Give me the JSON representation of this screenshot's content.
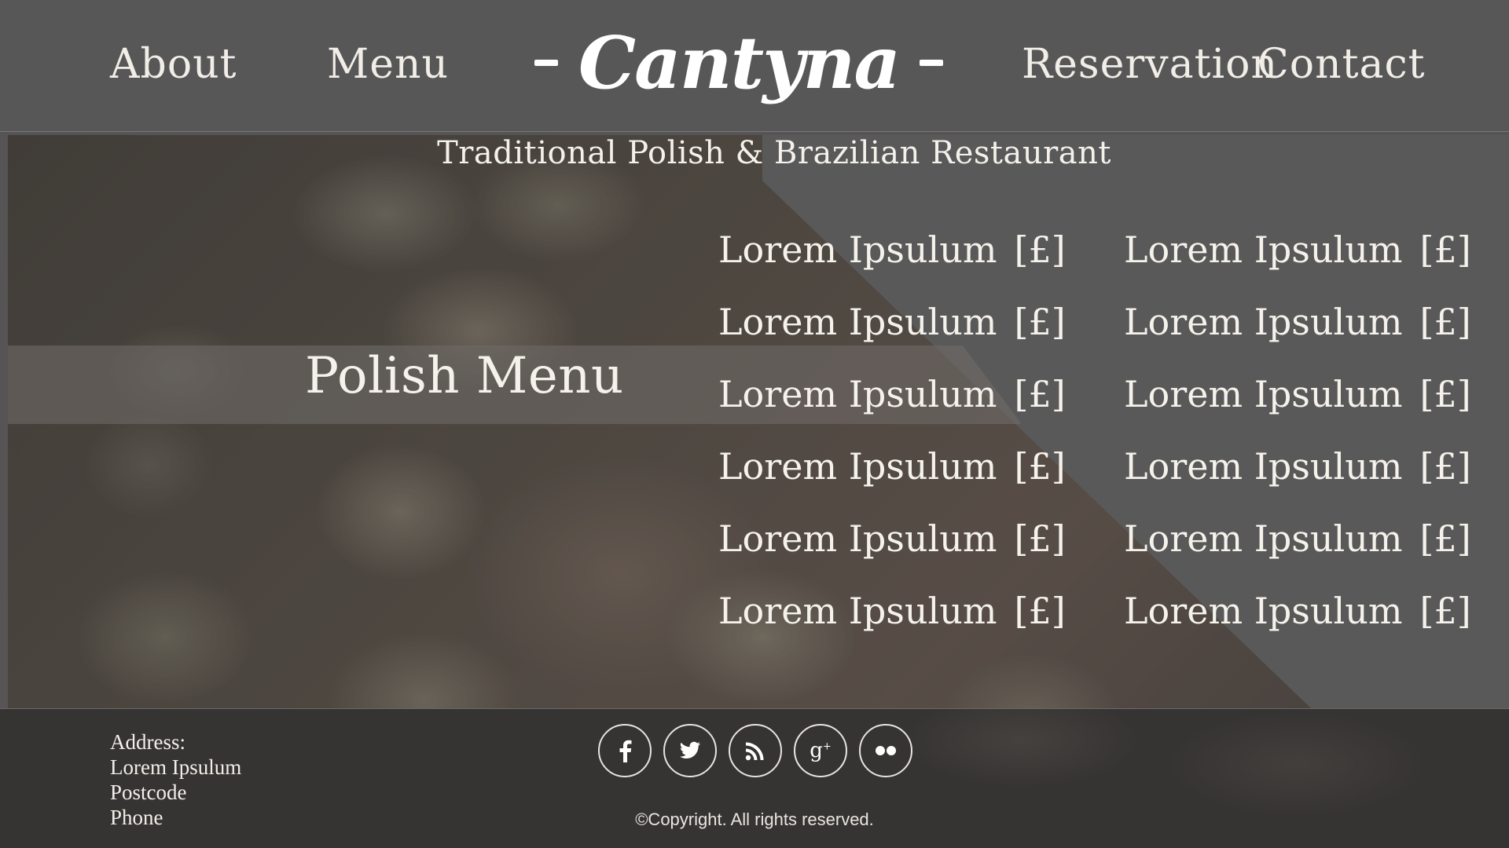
{
  "nav": {
    "about": "About",
    "menu": "Menu",
    "reservation": "Reservation",
    "contact": "Contact"
  },
  "brand": {
    "logo": "Cantyna"
  },
  "hero": {
    "tagline": "Traditional Polish & Brazilian Restaurant",
    "section_title": "Polish Menu",
    "menu_left": [
      {
        "name": "Lorem Ipsulum",
        "price": "[£]"
      },
      {
        "name": "Lorem Ipsulum",
        "price": "[£]"
      },
      {
        "name": "Lorem Ipsulum",
        "price": "[£]"
      },
      {
        "name": "Lorem Ipsulum",
        "price": "[£]"
      },
      {
        "name": "Lorem Ipsulum",
        "price": "[£]"
      },
      {
        "name": "Lorem Ipsulum",
        "price": "[£]"
      }
    ],
    "menu_right": [
      {
        "name": "Lorem Ipsulum",
        "price": "[£]"
      },
      {
        "name": "Lorem Ipsulum",
        "price": "[£]"
      },
      {
        "name": "Lorem Ipsulum",
        "price": "[£]"
      },
      {
        "name": "Lorem Ipsulum",
        "price": "[£]"
      },
      {
        "name": "Lorem Ipsulum",
        "price": "[£]"
      },
      {
        "name": "Lorem Ipsulum",
        "price": "[£]"
      }
    ]
  },
  "footer": {
    "address_label": "Address:",
    "address_line": "Lorem Ipsulum",
    "postcode": "Postcode",
    "phone": "Phone",
    "socials": [
      "facebook-icon",
      "twitter-icon",
      "rss-icon",
      "google-plus-icon",
      "flickr-icon"
    ],
    "copyright": "©Copyright. All rights reserved."
  },
  "colors": {
    "header_bg": "#585757",
    "panel_bg": "#595858",
    "footer_bg": "#343130",
    "text": "#f3f0ea"
  }
}
